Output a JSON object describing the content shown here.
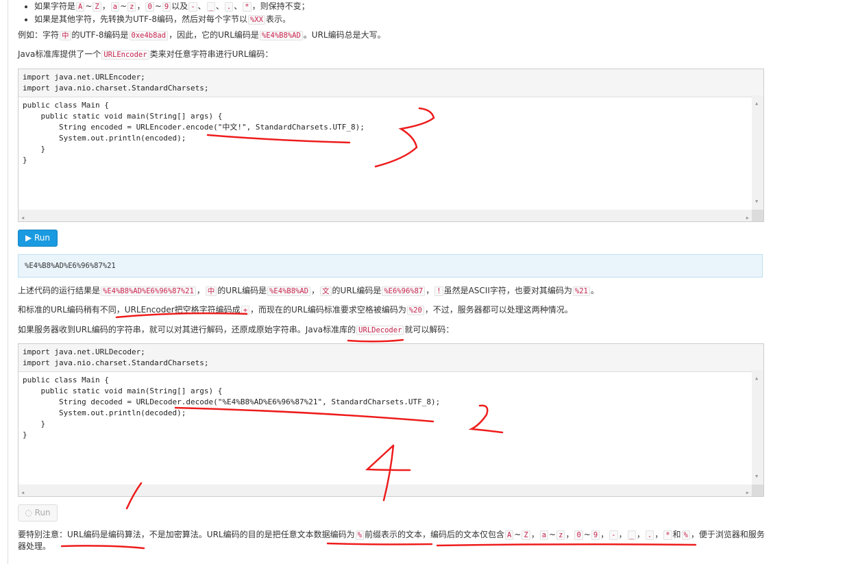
{
  "bullets": [
    [
      {
        "t": "如果字符是"
      },
      {
        "c": "A"
      },
      {
        "t": "~"
      },
      {
        "c": "Z"
      },
      {
        "t": "，"
      },
      {
        "c": "a"
      },
      {
        "t": "~"
      },
      {
        "c": "z"
      },
      {
        "t": "，"
      },
      {
        "c": "0"
      },
      {
        "t": "~"
      },
      {
        "c": "9"
      },
      {
        "t": "以及"
      },
      {
        "c": "-"
      },
      {
        "t": "、"
      },
      {
        "c": "_"
      },
      {
        "t": "、"
      },
      {
        "c": "."
      },
      {
        "t": "、"
      },
      {
        "c": "*"
      },
      {
        "t": "，则保持不变；"
      }
    ],
    [
      {
        "t": "如果是其他字符，先转换为UTF-8编码，然后对每个字节以"
      },
      {
        "c": "%XX"
      },
      {
        "t": "表示。"
      }
    ]
  ],
  "paragraphs": [
    [
      {
        "t": "例如：字符"
      },
      {
        "c": "中"
      },
      {
        "t": "的UTF-8编码是"
      },
      {
        "c": "0xe4b8ad"
      },
      {
        "t": "，因此，它的URL编码是"
      },
      {
        "c": "%E4%B8%AD"
      },
      {
        "t": "。URL编码总是大写。"
      }
    ],
    [
      {
        "t": "Java标准库提供了一个"
      },
      {
        "c": "URLEncoder"
      },
      {
        "t": "类来对任意字符串进行URL编码："
      }
    ],
    [
      {
        "t": "上述代码的运行结果是"
      },
      {
        "c": "%E4%B8%AD%E6%96%87%21"
      },
      {
        "t": "，"
      },
      {
        "c": "中"
      },
      {
        "t": "的URL编码是"
      },
      {
        "c": "%E4%B8%AD"
      },
      {
        "t": "，"
      },
      {
        "c": "文"
      },
      {
        "t": "的URL编码是"
      },
      {
        "c": "%E6%96%87"
      },
      {
        "t": "，"
      },
      {
        "c": "!"
      },
      {
        "t": "虽然是ASCII字符，也要对其编码为"
      },
      {
        "c": "%21"
      },
      {
        "t": "。"
      }
    ],
    [
      {
        "t": "和标准的URL编码稍有不同，URLEncoder把空格字符编码成"
      },
      {
        "c": "+"
      },
      {
        "t": "，而现在的URL编码标准要求空格被编码为"
      },
      {
        "c": "%20"
      },
      {
        "t": "，不过，服务器都可以处理这两种情况。"
      }
    ],
    [
      {
        "t": "如果服务器收到URL编码的字符串，就可以对其进行解码，还原成原始字符串。Java标准库的"
      },
      {
        "c": "URLDecoder"
      },
      {
        "t": "就可以解码："
      }
    ],
    [
      {
        "t": "要特别注意：URL编码是编码算法，不是加密算法。URL编码的目的是把任意文本数据编码为"
      },
      {
        "c": "%"
      },
      {
        "t": "前缀表示的文本，编码后的文本仅包含"
      },
      {
        "c": "A"
      },
      {
        "t": "~"
      },
      {
        "c": "Z"
      },
      {
        "t": "，"
      },
      {
        "c": "a"
      },
      {
        "t": "~"
      },
      {
        "c": "z"
      },
      {
        "t": "，"
      },
      {
        "c": "0"
      },
      {
        "t": "~"
      },
      {
        "c": "9"
      },
      {
        "t": "，"
      },
      {
        "c": "-"
      },
      {
        "t": "，"
      },
      {
        "c": "_"
      },
      {
        "t": "，"
      },
      {
        "c": "."
      },
      {
        "t": "，"
      },
      {
        "c": "*"
      },
      {
        "t": "和"
      },
      {
        "c": "%"
      },
      {
        "t": "，便于浏览器和服务"
      }
    ],
    [
      {
        "t": "器处理。"
      }
    ]
  ],
  "editor1": {
    "header": "import java.net.URLEncoder;\nimport java.nio.charset.StandardCharsets;",
    "body": "public class Main {\n    public static void main(String[] args) {\n        String encoded = URLEncoder.encode(\"中文!\", StandardCharsets.UTF_8);\n        System.out.println(encoded);\n    }\n}"
  },
  "run1": {
    "label": "▶ Run",
    "state": "ready"
  },
  "output1": "%E4%B8%AD%E6%96%87%21",
  "editor2": {
    "header": "import java.net.URLDecoder;\nimport java.nio.charset.StandardCharsets;",
    "body": "public class Main {\n    public static void main(String[] args) {\n        String decoded = URLDecoder.decode(\"%E4%B8%AD%E6%96%87%21\", StandardCharsets.UTF_8);\n        System.out.println(decoded);\n    }\n}"
  },
  "run2": {
    "label": "Run",
    "state": "running"
  },
  "colors": {
    "ink": "#ee1c1c",
    "run": "#1a9ae0",
    "code": "#c7254e"
  }
}
